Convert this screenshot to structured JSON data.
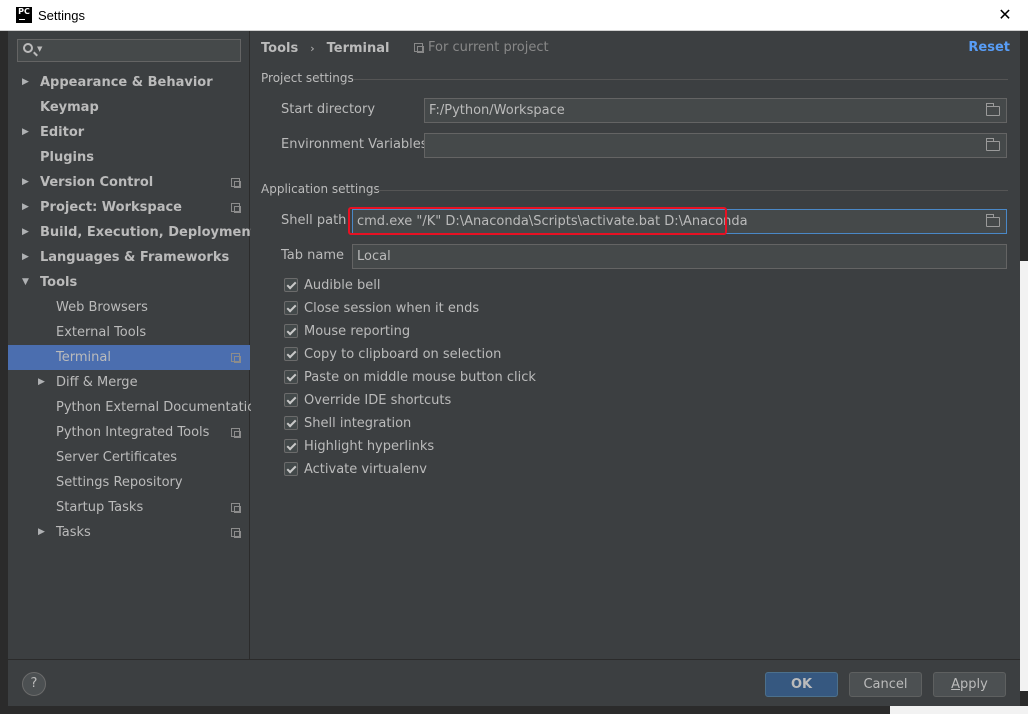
{
  "window": {
    "title": "Settings",
    "logo_text": "PC",
    "close_glyph": "✕"
  },
  "search": {
    "placeholder": "",
    "value": ""
  },
  "sidebar": {
    "items": [
      {
        "label": "Appearance & Behavior",
        "level": 0,
        "arrow": "▶",
        "bold": true,
        "project": false
      },
      {
        "label": "Keymap",
        "level": 0,
        "arrow": "",
        "bold": true,
        "project": false
      },
      {
        "label": "Editor",
        "level": 0,
        "arrow": "▶",
        "bold": true,
        "project": false
      },
      {
        "label": "Plugins",
        "level": 0,
        "arrow": "",
        "bold": true,
        "project": false
      },
      {
        "label": "Version Control",
        "level": 0,
        "arrow": "▶",
        "bold": true,
        "project": true
      },
      {
        "label": "Project: Workspace",
        "level": 0,
        "arrow": "▶",
        "bold": true,
        "project": true
      },
      {
        "label": "Build, Execution, Deployment",
        "level": 0,
        "arrow": "▶",
        "bold": true,
        "project": false
      },
      {
        "label": "Languages & Frameworks",
        "level": 0,
        "arrow": "▶",
        "bold": true,
        "project": false
      },
      {
        "label": "Tools",
        "level": 0,
        "arrow": "▼",
        "bold": true,
        "project": false
      },
      {
        "label": "Web Browsers",
        "level": 1,
        "arrow": "",
        "bold": false,
        "project": false
      },
      {
        "label": "External Tools",
        "level": 1,
        "arrow": "",
        "bold": false,
        "project": false
      },
      {
        "label": "Terminal",
        "level": 1,
        "arrow": "",
        "bold": false,
        "project": true,
        "selected": true
      },
      {
        "label": "Diff & Merge",
        "level": 1,
        "arrow": "▶",
        "bold": false,
        "project": false
      },
      {
        "label": "Python External Documentation",
        "level": 1,
        "arrow": "",
        "bold": false,
        "project": false
      },
      {
        "label": "Python Integrated Tools",
        "level": 1,
        "arrow": "",
        "bold": false,
        "project": true
      },
      {
        "label": "Server Certificates",
        "level": 1,
        "arrow": "",
        "bold": false,
        "project": false
      },
      {
        "label": "Settings Repository",
        "level": 1,
        "arrow": "",
        "bold": false,
        "project": false
      },
      {
        "label": "Startup Tasks",
        "level": 1,
        "arrow": "",
        "bold": false,
        "project": true
      },
      {
        "label": "Tasks",
        "level": 1,
        "arrow": "▶",
        "bold": false,
        "project": true
      }
    ]
  },
  "content": {
    "breadcrumb": [
      "Tools",
      "Terminal"
    ],
    "breadcrumb_sep": "›",
    "for_current_project": "For current project",
    "reset_label": "Reset",
    "project_settings": {
      "title": "Project settings",
      "start_directory_label": "Start directory",
      "start_directory_value": "F:/Python/Workspace",
      "env_vars_label": "Environment Variables",
      "env_vars_value": ""
    },
    "application_settings": {
      "title": "Application settings",
      "shell_path_label": "Shell path",
      "shell_path_value": "cmd.exe \"/K\" D:\\Anaconda\\Scripts\\activate.bat D:\\Anaconda",
      "tab_name_label": "Tab name",
      "tab_name_value": "Local",
      "checkboxes": [
        {
          "label": "Audible bell",
          "checked": true
        },
        {
          "label": "Close session when it ends",
          "checked": true
        },
        {
          "label": "Mouse reporting",
          "checked": true
        },
        {
          "label": "Copy to clipboard on selection",
          "checked": true
        },
        {
          "label": "Paste on middle mouse button click",
          "checked": true
        },
        {
          "label": "Override IDE shortcuts",
          "checked": true
        },
        {
          "label": "Shell integration",
          "checked": true
        },
        {
          "label": "Highlight hyperlinks",
          "checked": true
        },
        {
          "label": "Activate virtualenv",
          "checked": true
        }
      ]
    }
  },
  "footer": {
    "help_label": "?",
    "ok_label": "OK",
    "cancel_label": "Cancel",
    "apply_first": "A",
    "apply_rest": "pply"
  },
  "colors": {
    "background": "#3c3f41",
    "selection": "#4b6eaf",
    "link": "#589df6",
    "highlight_border": "#e81123",
    "ok_button": "#365880"
  }
}
